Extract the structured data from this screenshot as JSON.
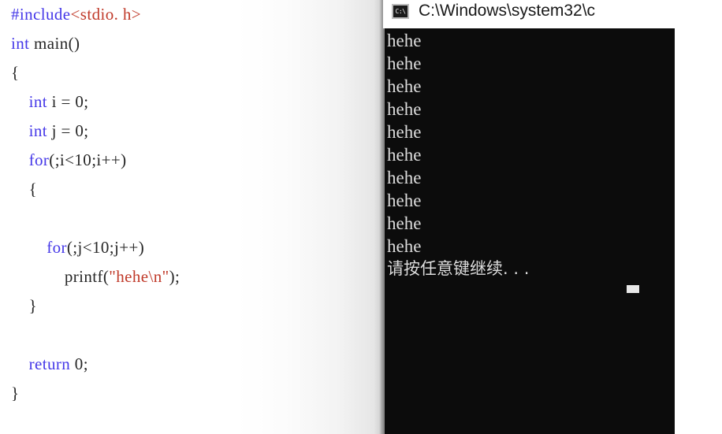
{
  "editor": {
    "language": "c",
    "lines": [
      {
        "indent": 0,
        "tokens": [
          {
            "t": "#include",
            "c": "pp"
          },
          {
            "t": "<stdio. h>",
            "c": "hdr"
          }
        ]
      },
      {
        "indent": 0,
        "tokens": [
          {
            "t": "int",
            "c": "kw"
          },
          {
            "t": " main()",
            "c": "plain"
          }
        ]
      },
      {
        "indent": 0,
        "tokens": [
          {
            "t": "{",
            "c": "plain"
          }
        ]
      },
      {
        "indent": 1,
        "tokens": [
          {
            "t": "int",
            "c": "kw"
          },
          {
            "t": " i = 0;",
            "c": "plain"
          }
        ]
      },
      {
        "indent": 1,
        "tokens": [
          {
            "t": "int",
            "c": "kw"
          },
          {
            "t": " j = 0;",
            "c": "plain"
          }
        ]
      },
      {
        "indent": 1,
        "tokens": [
          {
            "t": "for",
            "c": "kw"
          },
          {
            "t": "(;i<10;i++)",
            "c": "plain"
          }
        ]
      },
      {
        "indent": 1,
        "tokens": [
          {
            "t": "{",
            "c": "plain"
          }
        ]
      },
      {
        "indent": 0,
        "tokens": []
      },
      {
        "indent": 2,
        "tokens": [
          {
            "t": "for",
            "c": "kw"
          },
          {
            "t": "(;j<10;j++)",
            "c": "plain"
          }
        ]
      },
      {
        "indent": 3,
        "tokens": [
          {
            "t": "printf(",
            "c": "plain"
          },
          {
            "t": "\"hehe\\n\"",
            "c": "str"
          },
          {
            "t": ");",
            "c": "plain"
          }
        ]
      },
      {
        "indent": 1,
        "tokens": [
          {
            "t": "}",
            "c": "plain"
          }
        ]
      },
      {
        "indent": 0,
        "tokens": []
      },
      {
        "indent": 1,
        "tokens": [
          {
            "t": "return",
            "c": "kw"
          },
          {
            "t": " 0;",
            "c": "plain"
          }
        ]
      },
      {
        "indent": 0,
        "tokens": [
          {
            "t": "}",
            "c": "plain"
          }
        ]
      }
    ]
  },
  "console": {
    "titlebar": {
      "icon": "console-cmd-icon",
      "icon_glyph": "C:\\",
      "title": "C:\\Windows\\system32\\c"
    },
    "background_color": "#0c0c0c",
    "text_color": "#dcdcdc",
    "output_lines": [
      "hehe",
      "hehe",
      "hehe",
      "hehe",
      "hehe",
      "hehe",
      "hehe",
      "hehe",
      "hehe",
      "hehe"
    ],
    "prompt_line": "请按任意键继续. . .",
    "cursor_visible": true
  },
  "colors": {
    "keyword": "#4538e8",
    "preprocessor": "#4538e8",
    "string": "#c03a2a",
    "plain_text": "#262626",
    "console_bg": "#0c0c0c",
    "console_fg": "#dcdcdc",
    "page_bg": "#ffffff"
  }
}
